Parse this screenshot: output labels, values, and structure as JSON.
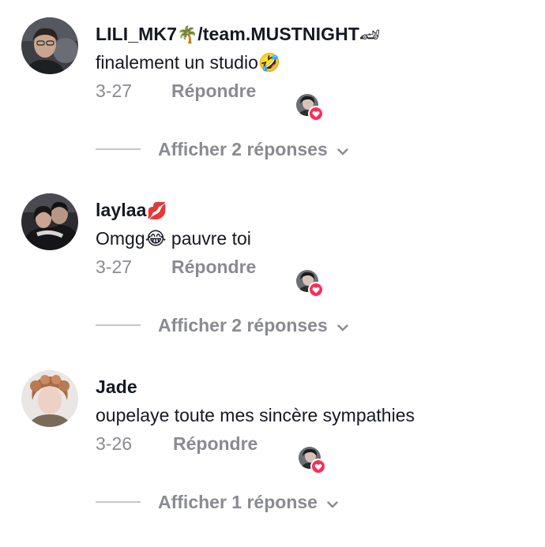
{
  "comments": [
    {
      "username": "LILI_MK7",
      "username_emoji_1": "🌴",
      "username_suffix": "/team.MUSTNIGHT",
      "username_emoji_2": "🏎",
      "text": "finalement un studio🤣",
      "date": "3-27",
      "reply_label": "Répondre",
      "replies_label": "Afficher 2 réponses",
      "avatar_icon": "person-photo-avatar"
    },
    {
      "username": "laylaa",
      "username_emoji_1": "💋",
      "text": "Omgg😂 pauvre toi",
      "date": "3-27",
      "reply_label": "Répondre",
      "replies_label": "Afficher 2 réponses",
      "avatar_icon": "couple-photo-avatar"
    },
    {
      "username": "Jade",
      "text": "oupelaye toute mes sincère sympathies",
      "date": "3-26",
      "reply_label": "Répondre",
      "replies_label": "Afficher 1 réponse",
      "avatar_icon": "person-photo-avatar"
    }
  ],
  "colors": {
    "text_primary": "#161823",
    "text_secondary": "#8a8b91",
    "heart_badge": "#fe2c55",
    "divider_line": "#c6c7cb"
  }
}
